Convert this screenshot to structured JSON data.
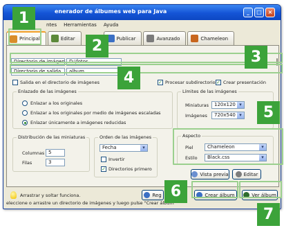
{
  "window": {
    "title": "enerador de álbumes web para Java"
  },
  "menu": {
    "items": [
      "ntes",
      "Herramientas",
      "Ayuda"
    ]
  },
  "tabs": [
    {
      "label": "Principal",
      "icon": "folder-icon",
      "color": "#d98d2a"
    },
    {
      "label": "Editar",
      "icon": "edit-icon",
      "color": "#5c8a3a"
    },
    {
      "label": "Publicar",
      "icon": "publish-icon",
      "color": "#3b6fc4"
    },
    {
      "label": "Avanzado",
      "icon": "advanced-icon",
      "color": "#7b7b7b"
    },
    {
      "label": "Chameleon",
      "icon": "chameleon-icon",
      "color": "#c8661e"
    }
  ],
  "dirs": {
    "images_label": "Directorio de imágenes",
    "images_value": "D:\\fotos",
    "output_label": "Directorio de salida",
    "output_value": "album"
  },
  "options": {
    "output_in_images": "Salida en el directorio de imágenes",
    "process_subdirs": "Procesar subdirectorios",
    "create_presentation": "Crear presentación"
  },
  "linking": {
    "title": "Enlazado de las imágenes",
    "opt1": "Enlazar a los originales",
    "opt2": "Enlazar a los originales por medio de imágenes escaladas",
    "opt3": "Enlazar únicamente a imágenes reducidas"
  },
  "limits": {
    "title": "Límites de las imágenes",
    "thumb_label": "Miniaturas",
    "thumb_value": "120x120",
    "img_label": "Imágenes",
    "img_value": "720x540"
  },
  "thumbs": {
    "title": "Distribución de las miniaturas",
    "cols_label": "Columnas",
    "cols_value": "5",
    "rows_label": "Filas",
    "rows_value": "3"
  },
  "order": {
    "title": "Orden de las imágenes",
    "value": "Fecha",
    "invert": "Invertir",
    "dirs_first": "Directorios primero"
  },
  "aspect": {
    "title": "Aspecto",
    "skin_label": "Piel",
    "skin_value": "Chameleon",
    "style_label": "Estilo",
    "style_value": "Black.css"
  },
  "buttons": {
    "preview": "Vista previa",
    "edit": "Editar",
    "regen": "Reg",
    "create": "Crear álbum",
    "view": "Ver álbum"
  },
  "hint": "Arrastrar y soltar funciona.",
  "status": "eleccione o arrastre un directorio de imágenes y luego pulse \"Crear álbum\"",
  "badges": [
    "1",
    "2",
    "3",
    "4",
    "5",
    "6",
    "7"
  ],
  "colors": {
    "badge": "#3ca33a",
    "highlight": "#9bd08e",
    "titlebar": "#1454d6"
  }
}
